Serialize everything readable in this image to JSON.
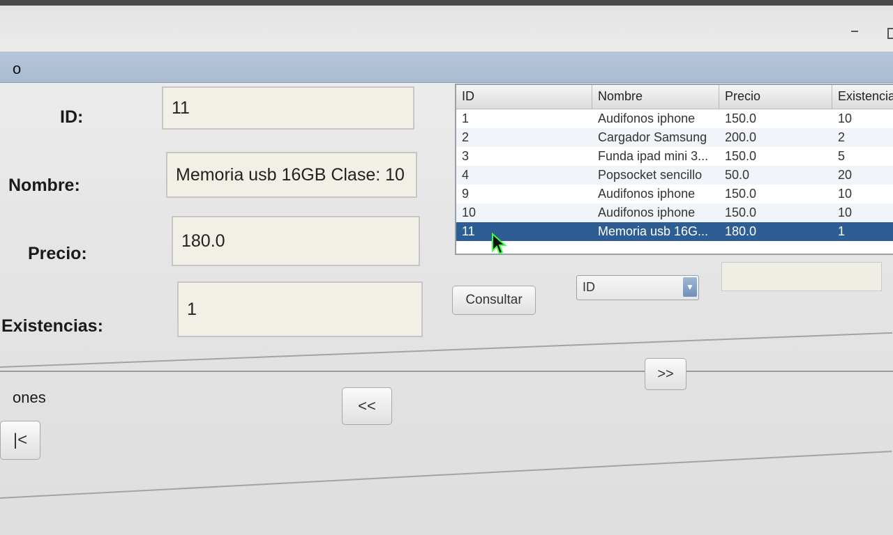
{
  "form": {
    "panel_title": "o",
    "id_label": "ID:",
    "id_value": "11",
    "nombre_label": "Nombre:",
    "nombre_value": "Memoria usb 16GB Clase: 10",
    "precio_label": "Precio:",
    "precio_value": "180.0",
    "existencias_label": "Existencias:",
    "existencias_value": "1"
  },
  "table": {
    "columns": [
      "ID",
      "Nombre",
      "Precio",
      "Existencia"
    ],
    "rows": [
      {
        "id": "1",
        "nombre": "Audifonos iphone",
        "precio": "150.0",
        "existencia": "10"
      },
      {
        "id": "2",
        "nombre": "Cargador Samsung",
        "precio": "200.0",
        "existencia": "2"
      },
      {
        "id": "3",
        "nombre": "Funda ipad mini 3...",
        "precio": "150.0",
        "existencia": "5"
      },
      {
        "id": "4",
        "nombre": "Popsocket sencillo",
        "precio": "50.0",
        "existencia": "20"
      },
      {
        "id": "9",
        "nombre": "Audifonos iphone",
        "precio": "150.0",
        "existencia": "10"
      },
      {
        "id": "10",
        "nombre": "Audifonos iphone",
        "precio": "150.0",
        "existencia": "10"
      },
      {
        "id": "11",
        "nombre": "Memoria usb 16G...",
        "precio": "180.0",
        "existencia": "1"
      }
    ],
    "selected_row": 6
  },
  "query": {
    "consultar_label": "Consultar",
    "field_selected": "ID",
    "search_value": ""
  },
  "navigation": {
    "section_title": "ones",
    "first_label": "|<",
    "prev_label": "<<",
    "next_label": ">>"
  },
  "colors": {
    "selection": "#2d5d93",
    "menubar": "#b7c7da",
    "field_bg": "#f2efe6"
  }
}
